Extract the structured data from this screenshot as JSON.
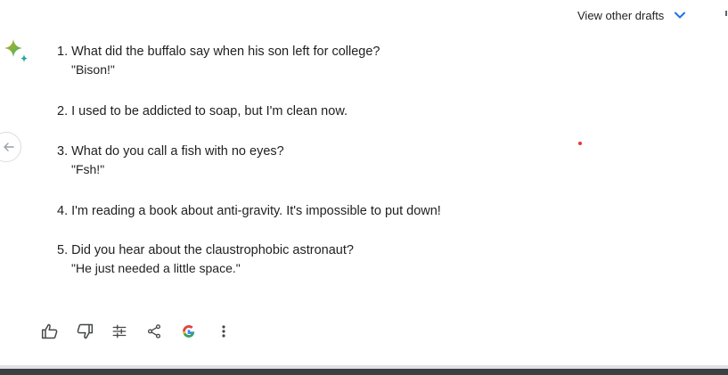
{
  "header": {
    "view_drafts_label": "View other drafts"
  },
  "response": {
    "jokes": [
      {
        "number": "1.",
        "text": "What did the buffalo say when his son left for college?",
        "punchline": "\"Bison!\""
      },
      {
        "number": "2.",
        "text": "I used to be addicted to soap, but I'm clean now.",
        "punchline": ""
      },
      {
        "number": "3.",
        "text": "What do you call a fish with no eyes?",
        "punchline": "\"Fsh!\""
      },
      {
        "number": "4.",
        "text": "I'm reading a book about anti-gravity. It's impossible to put down!",
        "punchline": ""
      },
      {
        "number": "5.",
        "text": "Did you hear about the claustrophobic astronaut?",
        "punchline": "\"He just needed a little space.\""
      }
    ]
  },
  "toolbar": {
    "icons": [
      "thumb-up-icon",
      "thumb-down-icon",
      "modify-response-icon",
      "share-icon",
      "google-it-icon",
      "more-options-icon"
    ]
  },
  "colors": {
    "accent_blue": "#1a73e8",
    "text": "#1f1f1f",
    "icon_gray": "#444746"
  }
}
